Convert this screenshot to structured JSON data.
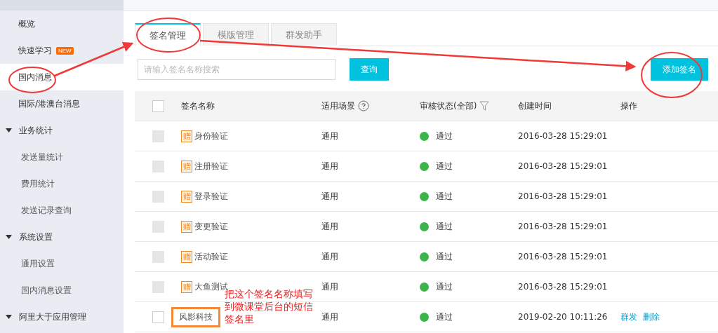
{
  "sidebar": {
    "items": [
      {
        "kind": "item",
        "label": "概览",
        "selected": false
      },
      {
        "kind": "item",
        "label": "快速学习",
        "badge": "NEW",
        "selected": false
      },
      {
        "kind": "item",
        "label": "国内消息",
        "selected": true
      },
      {
        "kind": "item",
        "label": "国际/港澳台消息",
        "selected": false
      },
      {
        "kind": "group",
        "label": "业务统计",
        "expanded": true,
        "children": [
          {
            "label": "发送量统计",
            "selected": false
          },
          {
            "label": "费用统计",
            "selected": false
          },
          {
            "label": "发送记录查询",
            "selected": false
          }
        ]
      },
      {
        "kind": "group",
        "label": "系统设置",
        "expanded": true,
        "children": [
          {
            "label": "通用设置",
            "selected": false
          },
          {
            "label": "国内消息设置",
            "selected": false
          }
        ]
      },
      {
        "kind": "group",
        "label": "阿里大于应用管理",
        "expanded": true
      }
    ]
  },
  "tabs": [
    {
      "label": "签名管理",
      "selected": true
    },
    {
      "label": "模版管理",
      "selected": false
    },
    {
      "label": "群发助手",
      "selected": false
    }
  ],
  "search": {
    "placeholder": "请输入签名名称搜索",
    "button": "查询"
  },
  "add_button": "添加签名",
  "table": {
    "all_checked": false,
    "columns": [
      "签名名称",
      "适用场景",
      "审核状态(全部)",
      "创建时间",
      "操作"
    ],
    "rows": [
      {
        "disabled": true,
        "badge": "赠",
        "name": "身份验证",
        "scene": "通用",
        "status": "通过",
        "created": "2016-03-28 15:29:01",
        "actions": [],
        "highlighted": false
      },
      {
        "disabled": true,
        "badge": "赠",
        "name": "注册验证",
        "scene": "通用",
        "status": "通过",
        "created": "2016-03-28 15:29:01",
        "actions": [],
        "highlighted": false
      },
      {
        "disabled": true,
        "badge": "赠",
        "name": "登录验证",
        "scene": "通用",
        "status": "通过",
        "created": "2016-03-28 15:29:01",
        "actions": [],
        "highlighted": false
      },
      {
        "disabled": true,
        "badge": "赠",
        "name": "变更验证",
        "scene": "通用",
        "status": "通过",
        "created": "2016-03-28 15:29:01",
        "actions": [],
        "highlighted": false
      },
      {
        "disabled": true,
        "badge": "赠",
        "name": "活动验证",
        "scene": "通用",
        "status": "通过",
        "created": "2016-03-28 15:29:01",
        "actions": [],
        "highlighted": false
      },
      {
        "disabled": true,
        "badge": "赠",
        "name": "大鱼测试",
        "scene": "通用",
        "status": "通过",
        "created": "2016-03-28 15:29:01",
        "actions": [],
        "highlighted": false
      },
      {
        "disabled": false,
        "name": "风影科技",
        "scene": "通用",
        "status": "通过",
        "created": "2019-02-20 10:11:26",
        "actions": [
          "群发",
          "删除"
        ],
        "highlighted": true
      }
    ]
  },
  "annotation": {
    "note": "把这个签名名称填写到微课堂后台的短信签名里"
  }
}
